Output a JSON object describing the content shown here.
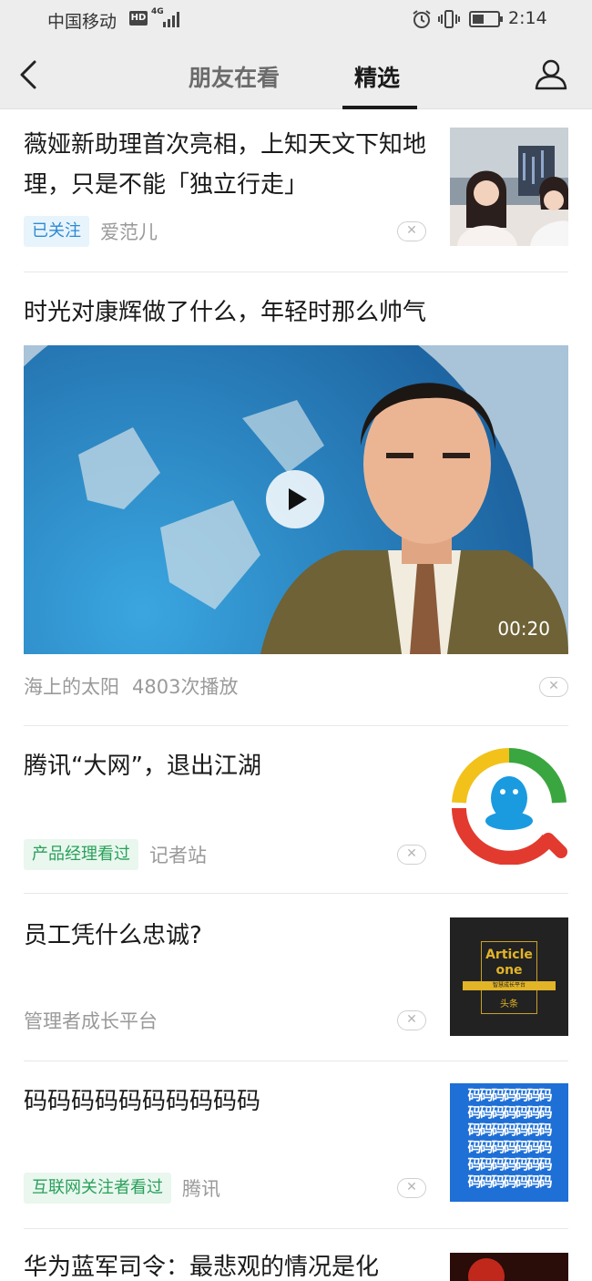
{
  "status": {
    "carrier": "中国移动",
    "hd": "HD",
    "network": "4G",
    "time": "2:14"
  },
  "nav": {
    "tabs": [
      "朋友在看",
      "精选"
    ],
    "active_tab": "精选",
    "icons": [
      "back-arrow-icon",
      "user-icon"
    ]
  },
  "feed": [
    {
      "title": "薇娅新助理首次亮相，上知天文下知地理，只是不能「独立行走」",
      "tag": "已关注",
      "source": "爱范儿",
      "close": "✕"
    },
    {
      "title": "时光对康辉做了什么，年轻时那么帅气",
      "source": "海上的太阳",
      "plays": "4803次播放",
      "duration": "00:20",
      "close": "✕"
    },
    {
      "title": "腾讯“大网”，退出江湖",
      "tag": "产品经理看过",
      "source": "记者站",
      "close": "✕"
    },
    {
      "title": "员工凭什么忠诚?",
      "source": "管理者成长平台",
      "close": "✕"
    },
    {
      "title": "码码码码码码码码码码",
      "tag": "互联网关注者看过",
      "source": "腾讯",
      "close": "✕"
    },
    {
      "title": "华为蓝军司令：最悲观的情况是化"
    }
  ],
  "thumbs": {
    "article_one_line1": "Article",
    "article_one_line2": "one",
    "article_one_sub": "智慧成长平台",
    "article_one_brand": "头条",
    "ma_text": "码码码码码码码"
  },
  "colors": {
    "tag_blue": "#2c8ad4",
    "tag_green": "#2aa05a",
    "ma_blue": "#1e6fd6"
  }
}
